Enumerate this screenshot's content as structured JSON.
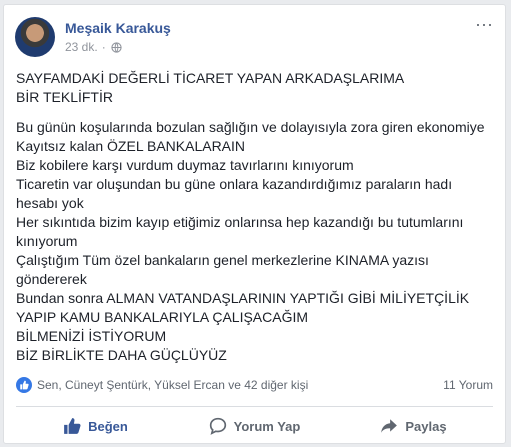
{
  "post": {
    "author": "Meşaik Karakuş",
    "time": "23 dk.",
    "separator": "·",
    "paragraphs": [
      [
        "SAYFAMDAKİ DEĞERLİ TİCARET YAPAN ARKADAŞLARIMA",
        "BİR TEKLİFTİR"
      ],
      [
        "Bu günün koşularında bozulan sağlığın ve dolayısıyla zora giren ekonomiye",
        "Kayıtsız kalan ÖZEL BANKALARAIN",
        "Biz kobilere karşı vurdum duymaz tavırlarını kınıyorum",
        "Ticaretin var oluşundan bu güne onlara kazandırdığımız paraların hadı",
        "hesabı yok",
        "Her sıkıntıda bizim kayıp etiğimiz onlarınsa hep kazandığı bu tutumlarını",
        "kınıyorum",
        "Çalıştığım Tüm özel bankaların genel merkezlerine KINAMA yazısı",
        "göndererek",
        "Bundan sonra ALMAN VATANDAŞLARININ YAPTIĞI GİBİ MİLİYETÇİLİK",
        "YAPIP KAMU BANKALARIYLA ÇALIŞACAĞIM",
        "BİLMENİZİ İSTİYORUM",
        "BİZ BİRLİKTE DAHA GÜÇLÜYÜZ"
      ]
    ]
  },
  "reactions": {
    "names": "Sen, Cüneyt Şentürk, Yüksel Ercan ve 42 diğer kişi",
    "comments": "11 Yorum"
  },
  "actions": {
    "like": "Beğen",
    "comment": "Yorum Yap",
    "share": "Paylaş"
  },
  "colors": {
    "accent": "#385898",
    "like_blue": "#3578e5"
  },
  "icons": [
    "globe-icon",
    "more-options-icon",
    "like-reaction-icon",
    "like-thumb-icon",
    "comment-icon",
    "share-icon"
  ]
}
